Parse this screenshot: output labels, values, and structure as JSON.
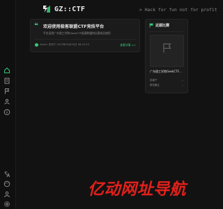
{
  "header": {
    "brand": "GZ::CTF",
    "slogan": "> Hack for fun not for profit"
  },
  "welcome": {
    "title": "欢迎使用极客联盟CTF竞技平台",
    "description": "平台适用广东理工学院GeekCTF极客联盟的比赛成员使用",
    "author": "Admin 发布于 2023年09月30日 08:10:23",
    "more_label": "查看详情 >>"
  },
  "recent": {
    "title": "近期比赛",
    "contest_name": "广东理工学院GeekCTF新生赛",
    "status_label": "结束于",
    "status_value": "--",
    "registration_label": "报名截止",
    "registration_value": "--"
  },
  "watermark": "亿动网址导航",
  "icons": {
    "logo": "gz-logo-icon",
    "quote": "quote-icon",
    "flag": "flag-icon",
    "contest_placeholder": "flag-outline-icon"
  },
  "colors": {
    "background": "#121212",
    "card": "#1b1b1b",
    "accent": "#36c97a",
    "watermark": "#e3201b"
  }
}
